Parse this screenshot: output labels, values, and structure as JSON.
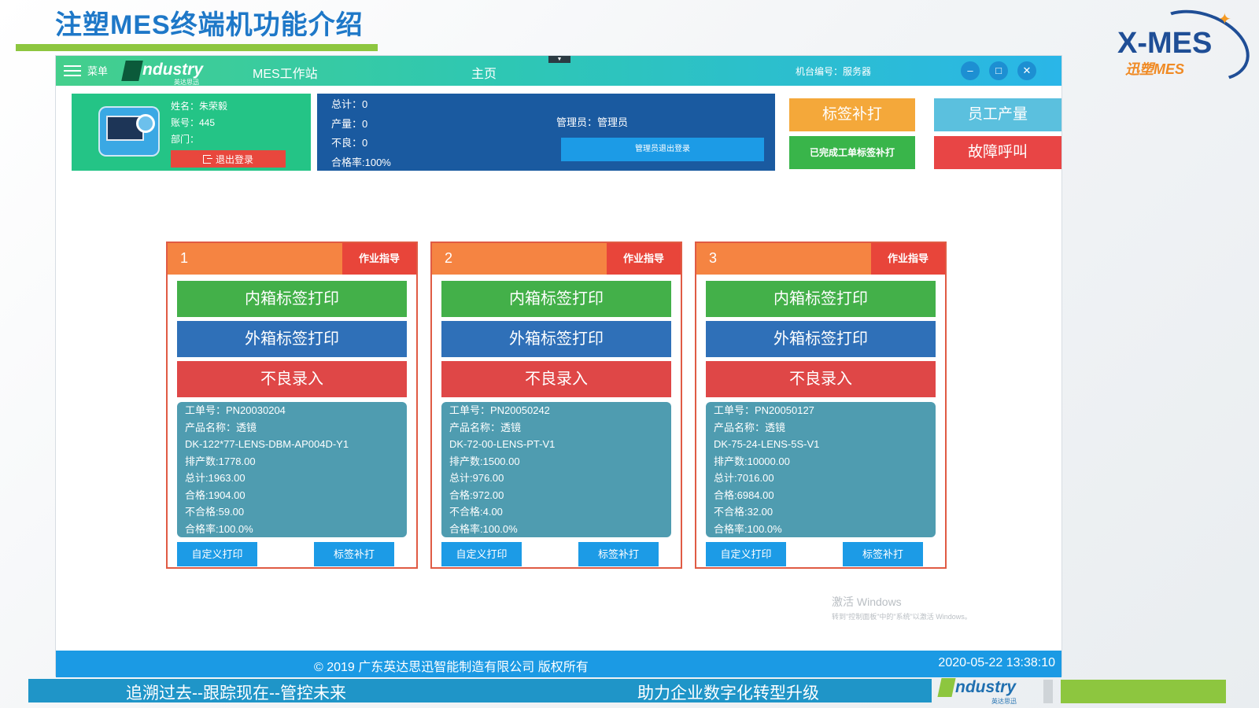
{
  "slide": {
    "title": "注塑MES终端机功能介绍",
    "brand_logo_main": "X-MES",
    "brand_logo_sub": "迅塑MES",
    "slogan_left": "追溯过去--跟踪现在--管控未来",
    "slogan_right": "助力企业数字化转型升级",
    "bottom_logo_word": "ndustry",
    "bottom_logo_sub": "英达思迅",
    "colors": {
      "title": "#1e78c8",
      "accent_green": "#8dc63f",
      "band_blue": "#1f95c8"
    }
  },
  "header": {
    "menu_label": "菜单",
    "logo_word": "ndustry",
    "logo_sub": "英达思迅",
    "station_name": "MES工作站",
    "home_label": "主页",
    "machine_no": "机台编号：服务器",
    "window_buttons": {
      "minimize": "–",
      "maximize": "□",
      "close": "✕"
    }
  },
  "user": {
    "name_line": "姓名：朱荣毅",
    "account_line": "账号：445",
    "dept_line": "部门：",
    "logout_label": "退出登录"
  },
  "stats": {
    "total_line": "总计：0",
    "output_line": "产量：0",
    "defect_line": "不良：0",
    "pass_rate_line": "合格率:100%",
    "admin_line": "管理员：管理员",
    "admin_logout_label": "管理员退出登录"
  },
  "actions": {
    "reprint_label": "标签补打",
    "completed_reprint_label": "已完成工单标签补打",
    "staff_output_label": "员工产量",
    "fault_call_label": "故障呼叫"
  },
  "panels": [
    {
      "number": "1",
      "guide_label": "作业指导",
      "inner_label": "内箱标签打印",
      "outer_label": "外箱标签打印",
      "bad_label": "不良录入",
      "info": [
        "工单号：PN20030204",
        "产品名称：透镜",
        "DK-122*77-LENS-DBM-AP004D-Y1",
        "排产数:1778.00",
        "总计:1963.00",
        "合格:1904.00",
        "不合格:59.00",
        "合格率:100.0%"
      ],
      "custom_print_label": "自定义打印",
      "reprint_label": "标签补打"
    },
    {
      "number": "2",
      "guide_label": "作业指导",
      "inner_label": "内箱标签打印",
      "outer_label": "外箱标签打印",
      "bad_label": "不良录入",
      "info": [
        "工单号：PN20050242",
        "产品名称：透镜",
        "DK-72-00-LENS-PT-V1",
        "排产数:1500.00",
        "总计:976.00",
        "合格:972.00",
        "不合格:4.00",
        "合格率:100.0%"
      ],
      "custom_print_label": "自定义打印",
      "reprint_label": "标签补打"
    },
    {
      "number": "3",
      "guide_label": "作业指导",
      "inner_label": "内箱标签打印",
      "outer_label": "外箱标签打印",
      "bad_label": "不良录入",
      "info": [
        "工单号：PN20050127",
        "产品名称：透镜",
        "DK-75-24-LENS-5S-V1",
        "排产数:10000.00",
        "总计:7016.00",
        "合格:6984.00",
        "不合格:32.00",
        "合格率:100.0%"
      ],
      "custom_print_label": "自定义打印",
      "reprint_label": "标签补打"
    }
  ],
  "watermark": {
    "line1": "激活 Windows",
    "line2": "转到\"控制面板\"中的\"系统\"以激活 Windows。"
  },
  "footer": {
    "copyright": "© 2019 广东英达思迅智能制造有限公司 版权所有",
    "datetime": "2020-05-22 13:38:10"
  }
}
